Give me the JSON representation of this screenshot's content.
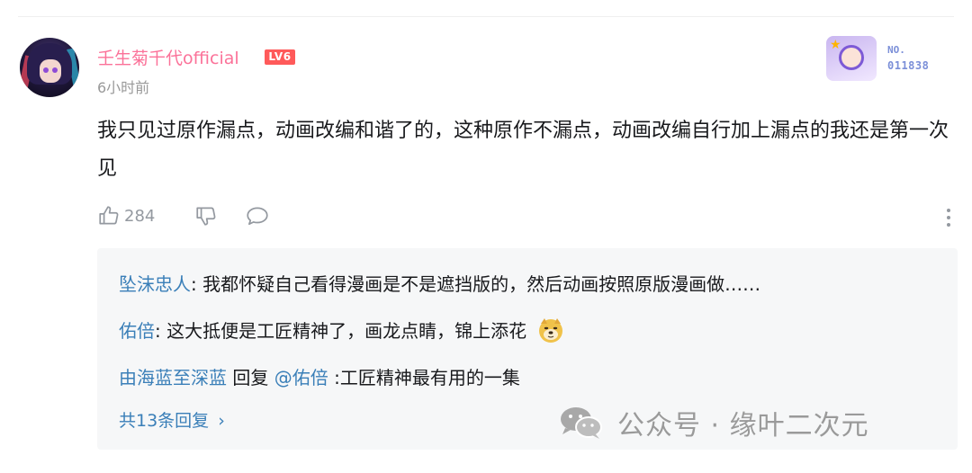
{
  "comment": {
    "username": "壬生菊千代official",
    "level_badge": "LV6",
    "time": "6小时前",
    "fan_badge": {
      "no_label": "NO.",
      "number": "011838"
    },
    "text": "我只见过原作漏点，动画改编和谐了的，这种原作不漏点，动画改编自行加上漏点的我还是第一次见",
    "like_count": "284",
    "icons": [
      "thumbs-up-icon",
      "thumbs-down-icon",
      "reply-bubble-icon",
      "more-dots-icon"
    ]
  },
  "replies": [
    {
      "name": "坠沫忠人",
      "separator": ": ",
      "text": "我都怀疑自己看得漫画是不是遮挡版的，然后动画按照原版漫画做……"
    },
    {
      "name": "佑倍",
      "separator": ": ",
      "text": "这大抵便是工匠精神了，画龙点睛，锦上添花",
      "emoji": "doge-emoji"
    },
    {
      "name": "由海蓝至深蓝",
      "reply_word": " 回复 ",
      "mention": "@佑倍",
      "separator": " :",
      "text": "工匠精神最有用的一集"
    }
  ],
  "replies_footer": {
    "total": "共13条回复",
    "chevron": "›"
  },
  "watermark": {
    "text": "公众号 · 缘叶二次元",
    "icon": "wechat-icon"
  },
  "colors": {
    "username": "#fb7299",
    "level_badge": "#ff5a5a",
    "reply_name": "#3a7fb8",
    "muted": "#9499a0",
    "reply_bg": "#f6f7f8"
  }
}
